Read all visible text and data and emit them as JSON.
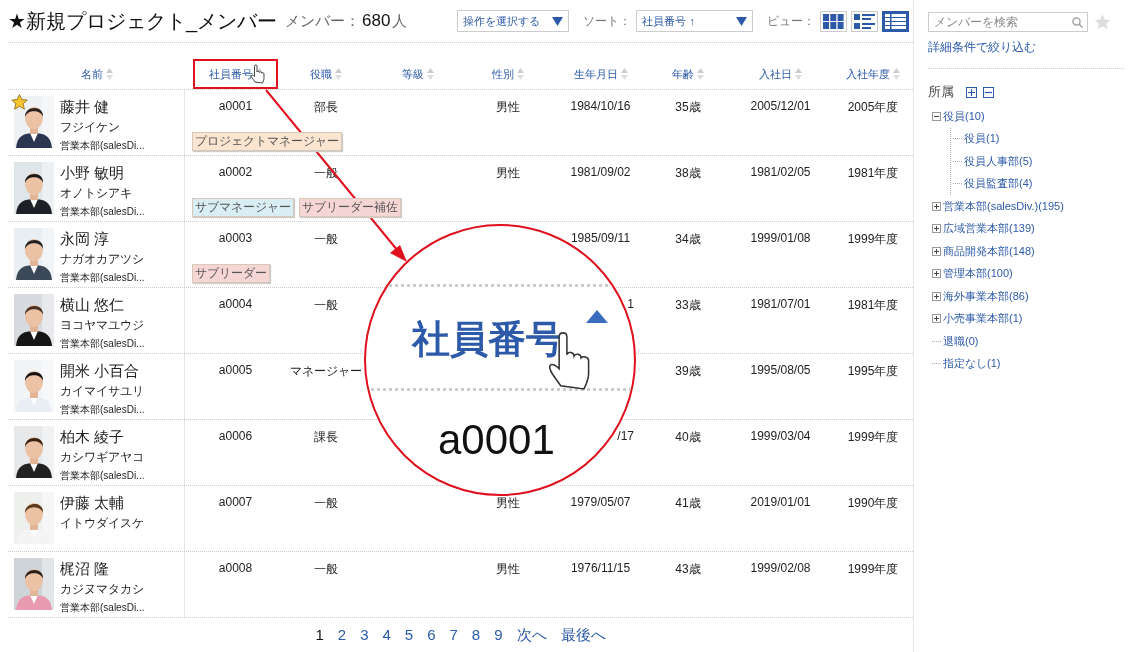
{
  "header": {
    "title": "★新規プロジェクト_メンバー",
    "count_label": "メンバー：",
    "count": "680",
    "count_unit": "人",
    "action_select": "操作を選択する",
    "sort_label": "ソート：",
    "sort_select": "社員番号 ↑",
    "view_label": "ビュー：",
    "views": [
      {
        "kind": "tiles",
        "selected": false
      },
      {
        "kind": "list",
        "selected": false
      },
      {
        "kind": "table",
        "selected": true
      }
    ]
  },
  "table": {
    "name_column": "名前",
    "columns": [
      {
        "label": "社員番号",
        "highlighted": true
      },
      {
        "label": "役職",
        "highlighted": false
      },
      {
        "label": "等級",
        "highlighted": false
      },
      {
        "label": "性別",
        "highlighted": false
      },
      {
        "label": "生年月日",
        "highlighted": false
      },
      {
        "label": "年齢",
        "highlighted": false
      },
      {
        "label": "入社日",
        "highlighted": false
      },
      {
        "label": "入社年度",
        "highlighted": false
      }
    ],
    "rows": [
      {
        "name": "藤井 健",
        "kana": "フジイケン",
        "dept": "営業本部(salesDi...",
        "favorite": true,
        "cells": [
          "a0001",
          "部長",
          null,
          "男性",
          "1984/10/16",
          "35歳",
          "2005/12/01",
          "2005年度"
        ],
        "tags": [
          {
            "label": "プロジェクトマネージャー",
            "color": "#fbe4d0"
          }
        ]
      },
      {
        "name": "小野 敏明",
        "kana": "オノトシアキ",
        "dept": "営業本部(salesDi...",
        "favorite": false,
        "cells": [
          "a0002",
          "一般",
          null,
          "男性",
          "1981/09/02",
          "38歳",
          "1981/02/05",
          "1981年度"
        ],
        "tags": [
          {
            "label": "サブマネージャー",
            "color": "#d9eef4"
          },
          {
            "label": "サブリーダー補佐",
            "color": "#f6d5d5"
          }
        ]
      },
      {
        "name": "永岡 淳",
        "kana": "ナガオカアツシ",
        "dept": "営業本部(salesDi...",
        "favorite": false,
        "cells": [
          "a0003",
          "一般",
          null,
          null,
          "1985/09/11",
          "34歳",
          "1999/01/08",
          "1999年度"
        ],
        "tags": [
          {
            "label": "サブリーダー",
            "color": "#f6d5d5"
          }
        ]
      },
      {
        "name": "横山 悠仁",
        "kana": "ヨコヤマユウジ",
        "dept": "営業本部(salesDi...",
        "favorite": false,
        "cells": [
          "a0004",
          "一般",
          null,
          null,
          "1",
          "33歳",
          "1981/07/01",
          "1981年度"
        ],
        "tags": []
      },
      {
        "name": "開米 小百合",
        "kana": "カイマイサユリ",
        "dept": "営業本部(salesDi...",
        "favorite": false,
        "cells": [
          "a0005",
          "マネージャー",
          null,
          null,
          null,
          "39歳",
          "1995/08/05",
          "1995年度"
        ],
        "tags": []
      },
      {
        "name": "柏木 綾子",
        "kana": "カシワギアヤコ",
        "dept": "営業本部(salesDi...",
        "favorite": false,
        "cells": [
          "a0006",
          "課長",
          null,
          null,
          "/17",
          "40歳",
          "1999/03/04",
          "1999年度"
        ],
        "tags": []
      },
      {
        "name": "伊藤 太輔",
        "kana": "イトウダイスケ",
        "favorite": false,
        "cells": [
          "a0007",
          "一般",
          null,
          "男性",
          "1979/05/07",
          "41歳",
          "2019/01/01",
          "1990年度"
        ],
        "tags": []
      },
      {
        "name": "梶沼 隆",
        "kana": "カジヌマタカシ",
        "dept": "営業本部(salesDi...",
        "favorite": false,
        "cells": [
          "a0008",
          "一般",
          null,
          "男性",
          "1976/11/15",
          "43歳",
          "1999/02/08",
          "1999年度"
        ],
        "tags": []
      }
    ]
  },
  "magnifier": {
    "header": "社員番号",
    "value": "a0001"
  },
  "pagination": [
    {
      "label": "1",
      "selected": true
    },
    {
      "label": "2",
      "selected": false
    },
    {
      "label": "3",
      "selected": false
    },
    {
      "label": "4",
      "selected": false
    },
    {
      "label": "5",
      "selected": false
    },
    {
      "label": "6",
      "selected": false
    },
    {
      "label": "7",
      "selected": false
    },
    {
      "label": "8",
      "selected": false
    },
    {
      "label": "9",
      "selected": false
    },
    {
      "label": "次へ",
      "selected": false
    },
    {
      "label": "最後へ",
      "selected": false
    }
  ],
  "sidebar": {
    "search_placeholder": "メンバーを検索",
    "filter_link": "詳細条件で絞り込む",
    "tree_title": "所属",
    "tree": [
      {
        "label": "役員(10)",
        "kind": "folder",
        "expanded": true,
        "children": [
          {
            "label": "役員(1)",
            "kind": "leaf"
          },
          {
            "label": "役員人事部(5)",
            "kind": "leaf"
          },
          {
            "label": "役員監査部(4)",
            "kind": "leaf"
          }
        ]
      },
      {
        "label": "営業本部(salesDiv.)(195)",
        "kind": "folder",
        "expanded": false
      },
      {
        "label": "広域営業本部(139)",
        "kind": "folder",
        "expanded": false
      },
      {
        "label": "商品開発本部(148)",
        "kind": "folder",
        "expanded": false
      },
      {
        "label": "管理本部(100)",
        "kind": "folder",
        "expanded": false
      },
      {
        "label": "海外事業本部(86)",
        "kind": "folder",
        "expanded": false
      },
      {
        "label": "小売事業本部(1)",
        "kind": "folder",
        "expanded": false
      },
      {
        "label": "退職(0)",
        "kind": "leaf"
      },
      {
        "label": "指定なし(1)",
        "kind": "leaf"
      }
    ]
  }
}
